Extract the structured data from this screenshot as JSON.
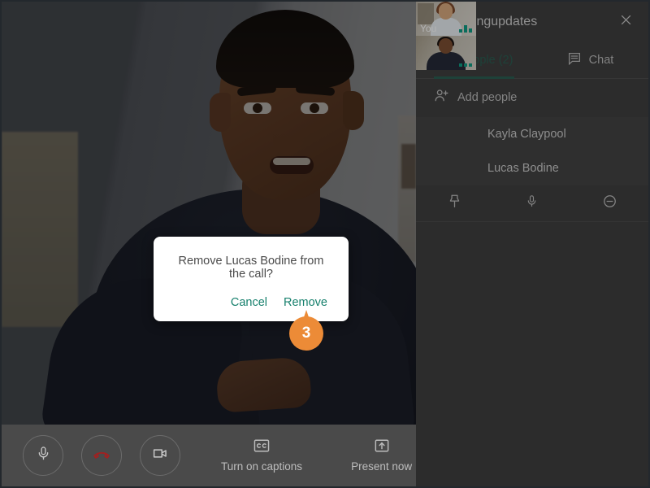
{
  "meeting": {
    "video_tile_label": "main-speaker-video"
  },
  "bottom_bar": {
    "mic_icon": "microphone-icon",
    "end_call_icon": "hangup-phone-icon",
    "camera_icon": "video-camera-icon",
    "captions_icon": "closed-captions-icon",
    "captions_label": "Turn on captions",
    "present_icon": "present-screen-icon",
    "present_label": "Present now"
  },
  "panel": {
    "title": "marketingupdates",
    "close_icon": "close-icon",
    "tabs": [
      {
        "label": "People (2)",
        "icon": "people-icon",
        "active": true
      },
      {
        "label": "Chat",
        "icon": "chat-bubble-icon",
        "active": false
      }
    ],
    "add_people": {
      "label": "Add people",
      "icon": "add-person-icon"
    },
    "people": [
      {
        "name": "Kayla Claypool",
        "self_label": "You"
      },
      {
        "name": "Lucas Bodine",
        "self_label": ""
      }
    ],
    "person_actions": [
      {
        "icon": "pin-icon",
        "name": "pin-person-button"
      },
      {
        "icon": "microphone-icon",
        "name": "mute-person-button"
      },
      {
        "icon": "remove-person-icon",
        "name": "remove-person-button"
      }
    ]
  },
  "dialog": {
    "message": "Remove Lucas Bodine from the call?",
    "cancel_label": "Cancel",
    "confirm_label": "Remove",
    "accent_color": "#17806d"
  },
  "step_marker": {
    "number": "3",
    "color": "#ec8b37"
  }
}
